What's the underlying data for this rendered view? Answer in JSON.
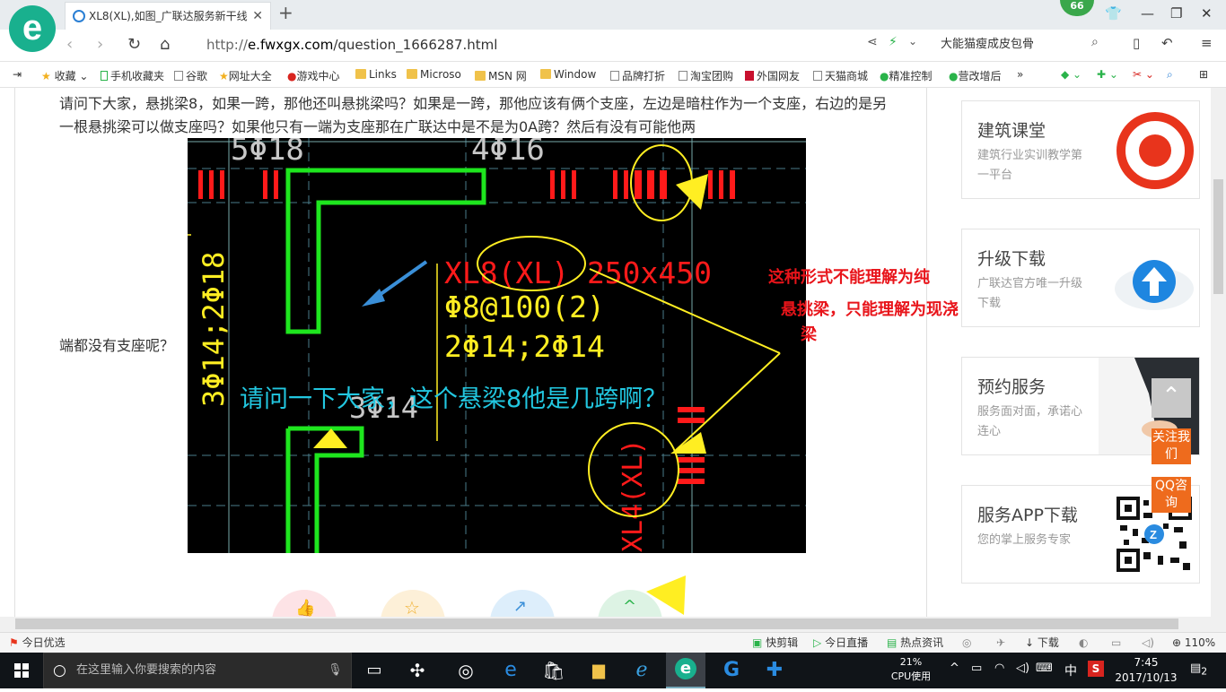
{
  "browser": {
    "logo_letter": "e",
    "tab_title": "XL8(XL),如图_广联达服务新干线",
    "badge_count": "66",
    "address_protocol": "http://",
    "address_host": "e.fwxgx.com",
    "address_path": "/question_1666287.html",
    "search_text": "大能猫瘦成皮包骨"
  },
  "bookmarks": {
    "items": [
      {
        "label": "收藏",
        "icon": "star-icon"
      },
      {
        "label": "手机收藏夹",
        "icon": "phone-icon"
      },
      {
        "label": "谷歌",
        "icon": "page-icon"
      },
      {
        "label": "网址大全",
        "icon": "star-icon"
      },
      {
        "label": "游戏中心",
        "icon": "game-icon"
      },
      {
        "label": "Links",
        "icon": "folder-icon"
      },
      {
        "label": "Microso",
        "icon": "folder-icon"
      },
      {
        "label": "MSN 网",
        "icon": "folder-icon"
      },
      {
        "label": "Window",
        "icon": "folder-icon"
      },
      {
        "label": "品牌打折",
        "icon": "page-icon"
      },
      {
        "label": "淘宝团购",
        "icon": "page-icon"
      },
      {
        "label": "外国网友",
        "icon": "flag-icon"
      },
      {
        "label": "天猫商城",
        "icon": "page-icon"
      },
      {
        "label": "精准控制",
        "icon": "chat-icon"
      },
      {
        "label": "营改增后",
        "icon": "chat-icon"
      }
    ],
    "more": "»"
  },
  "question": {
    "text": "请问下大家，悬挑梁8，如果一跨，那他还叫悬挑梁吗？如果是一跨，那他应该有俩个支座，左边是暗柱作为一个支座，右边的是另一根悬挑梁可以做支座吗？如果他只有一端为支座那在广联达中是不是为0A跨？然后有没有可能他两",
    "text_tail": "端都没有支座呢？"
  },
  "cad": {
    "label_top_left": "5Φ18",
    "label_top_mid": "4Φ16",
    "beam_name": "XL8(XL) 250x450",
    "stirrup": "Φ8@100(2)",
    "rebar": "2Φ14;2Φ14",
    "vertical_left": "3Φ14;2Φ18",
    "mid_label": "3Φ14",
    "cyan_question": "请问一下大家，这个悬梁8他是几跨啊？",
    "vertical_beam": "XL4(XL)",
    "annotation_line1": "这种形式不能理解为纯",
    "annotation_line2": "悬挑梁，只能理解为现浇",
    "annotation_line3": "梁"
  },
  "sidebar": {
    "cards": [
      {
        "title": "建筑课堂",
        "desc": "建筑行业实训教学第一平台"
      },
      {
        "title": "升级下载",
        "desc": "广联达官方唯一升级下载"
      },
      {
        "title": "预约服务",
        "desc": "服务面对面，承诺心连心"
      },
      {
        "title": "服务APP下载",
        "desc": "您的掌上服务专家"
      }
    ],
    "follow_label": "关注我们",
    "qq_label": "QQ咨询"
  },
  "statusbar": {
    "left": "今日优选",
    "items": [
      "快剪辑",
      "今日直播",
      "热点资讯",
      "下载"
    ],
    "zoom": "110%"
  },
  "taskbar": {
    "search_placeholder": "在这里输入你要搜索的内容",
    "cpu_percent": "21%",
    "cpu_label": "CPU使用",
    "ime": "中",
    "time": "7:45",
    "date": "2017/10/13",
    "notifications": "2"
  },
  "colors": {
    "brand_green": "#19b08e",
    "cad_green": "#1ee61e",
    "cad_red": "#ff1a1a",
    "cad_yellow": "#ffee22",
    "cad_cyan": "#22c7e0",
    "accent_orange": "#ee6b1d"
  }
}
